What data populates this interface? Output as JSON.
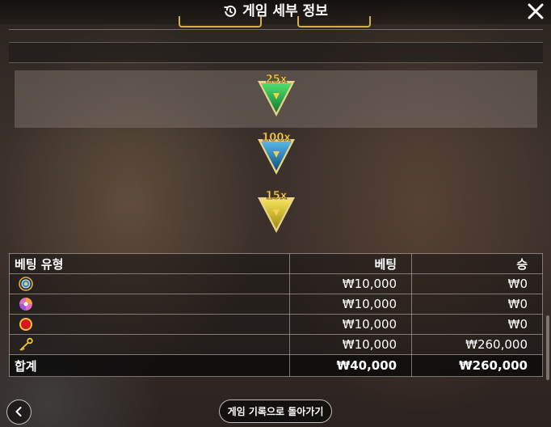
{
  "header": {
    "title": "게임 세부 정보",
    "icons": {
      "history": "history-icon",
      "close": "close-icon"
    }
  },
  "multipliers": [
    {
      "label": "25x",
      "color": "#23a84a"
    },
    {
      "label": "100x",
      "color": "#1f7fae"
    },
    {
      "label": "15x",
      "color": "#c9b520"
    }
  ],
  "table": {
    "headers": {
      "bet_type": "베팅 유형",
      "bet": "베팅",
      "win": "승"
    },
    "rows": [
      {
        "icon": "wheel-icon",
        "bet": "₩10,000",
        "win": "₩0"
      },
      {
        "icon": "candy-icon",
        "bet": "₩10,000",
        "win": "₩0"
      },
      {
        "icon": "red-ball-icon",
        "bet": "₩10,000",
        "win": "₩0"
      },
      {
        "icon": "key-icon",
        "bet": "₩10,000",
        "win": "₩260,000"
      }
    ],
    "total": {
      "label": "합계",
      "bet": "₩40,000",
      "win": "₩260,000"
    }
  },
  "footer": {
    "back_icon": "chevron-left-icon",
    "history_button": "게임 기록으로 돌아가기"
  },
  "colors": {
    "accent_gold": "#d4b04a",
    "win_gold": "#f0c63a"
  }
}
